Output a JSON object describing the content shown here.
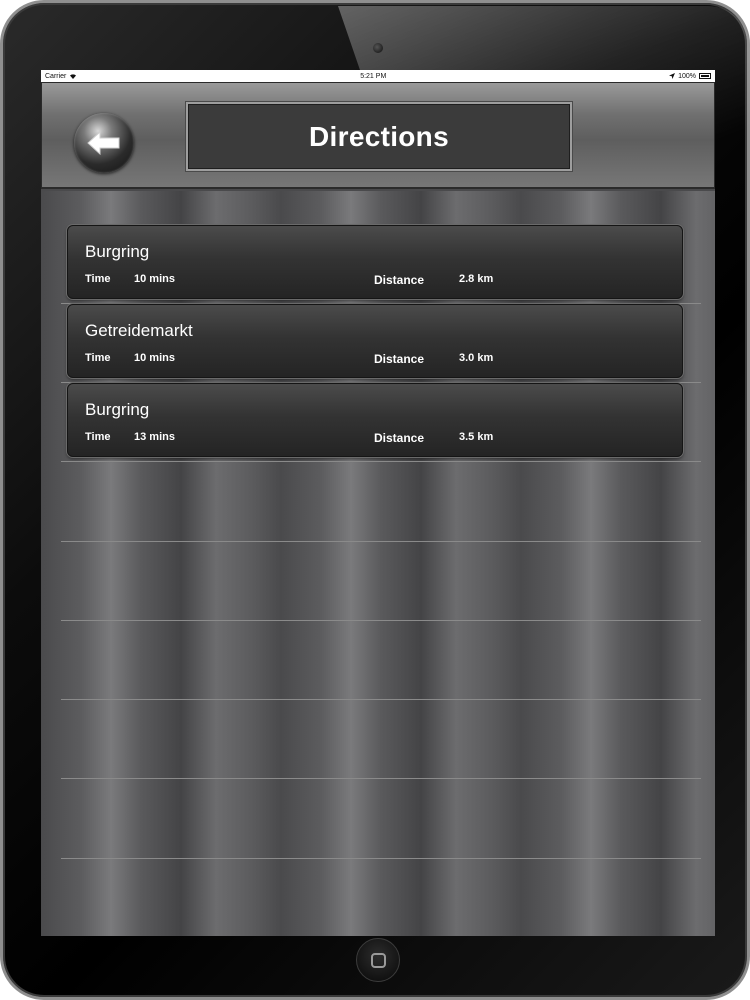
{
  "status_bar": {
    "carrier": "Carrier",
    "time": "5:21 PM",
    "battery": "100%"
  },
  "nav": {
    "title": "Directions",
    "back_icon": "arrow-left-icon"
  },
  "routes": [
    {
      "name": "Burgring",
      "time_label": "Time",
      "time": "10 mins",
      "distance_label": "Distance",
      "distance": "2.8 km"
    },
    {
      "name": "Getreidemarkt",
      "time_label": "Time",
      "time": "10 mins",
      "distance_label": "Distance",
      "distance": "3.0 km"
    },
    {
      "name": "Burgring",
      "time_label": "Time",
      "time": "13 mins",
      "distance_label": "Distance",
      "distance": "3.5 km"
    }
  ],
  "colors": {
    "title_text": "#ffffff",
    "card_bg": "#333333",
    "separator": "#8a8a8a"
  }
}
